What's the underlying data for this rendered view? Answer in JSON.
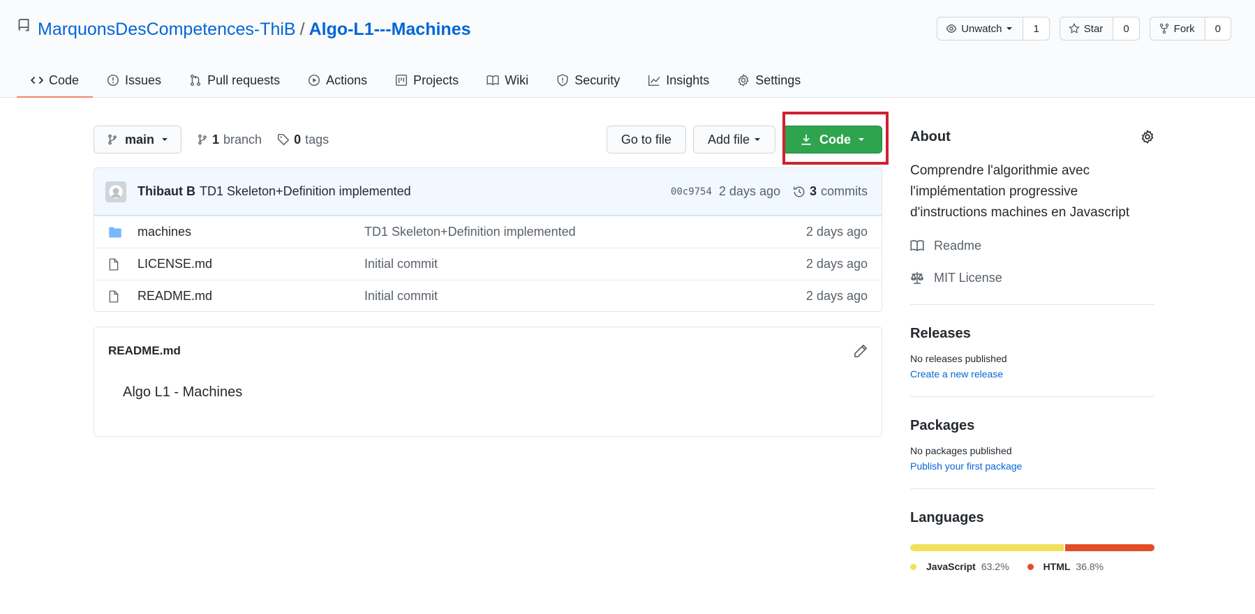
{
  "repo": {
    "owner": "MarquonsDesCompetences-ThiB",
    "separator": "/",
    "name": "Algo-L1---Machines"
  },
  "header_actions": {
    "watch_label": "Unwatch",
    "watch_count": "1",
    "star_label": "Star",
    "star_count": "0",
    "fork_label": "Fork",
    "fork_count": "0"
  },
  "tabs": [
    {
      "label": "Code",
      "icon": "code-icon"
    },
    {
      "label": "Issues",
      "icon": "issue-icon"
    },
    {
      "label": "Pull requests",
      "icon": "pull-request-icon"
    },
    {
      "label": "Actions",
      "icon": "play-icon"
    },
    {
      "label": "Projects",
      "icon": "project-icon"
    },
    {
      "label": "Wiki",
      "icon": "book-icon"
    },
    {
      "label": "Security",
      "icon": "shield-icon"
    },
    {
      "label": "Insights",
      "icon": "graph-icon"
    },
    {
      "label": "Settings",
      "icon": "gear-icon"
    }
  ],
  "filenav": {
    "branch": "main",
    "branch_count": "1",
    "branch_word": "branch",
    "tag_count": "0",
    "tag_word": "tags",
    "go_to_file": "Go to file",
    "add_file": "Add file",
    "code": "Code"
  },
  "latest_commit": {
    "author": "Thibaut B",
    "message": "TD1 Skeleton+Definition implemented",
    "sha": "00c9754",
    "age": "2 days ago",
    "commit_count": "3",
    "commit_word": "commits"
  },
  "files": [
    {
      "type": "dir",
      "name": "machines",
      "message": "TD1 Skeleton+Definition implemented",
      "age": "2 days ago"
    },
    {
      "type": "file",
      "name": "LICENSE.md",
      "message": "Initial commit",
      "age": "2 days ago"
    },
    {
      "type": "file",
      "name": "README.md",
      "message": "Initial commit",
      "age": "2 days ago"
    }
  ],
  "readme": {
    "title": "README.md",
    "content": "Algo L1 - Machines"
  },
  "about": {
    "title": "About",
    "description": "Comprendre l'algorithmie avec l'implémentation progressive d'instructions machines en Javascript",
    "readme_link": "Readme",
    "license_link": "MIT License"
  },
  "releases": {
    "title": "Releases",
    "none": "No releases published",
    "create": "Create a new release"
  },
  "packages": {
    "title": "Packages",
    "none": "No packages published",
    "publish": "Publish your first package"
  },
  "languages": {
    "title": "Languages",
    "items": [
      {
        "name": "JavaScript",
        "percent": "63.2%",
        "value": 63.2,
        "color": "#f1e05a"
      },
      {
        "name": "HTML",
        "percent": "36.8%",
        "value": 36.8,
        "color": "#e34c26"
      }
    ]
  },
  "colors": {
    "link": "#0366d6",
    "primary_button": "#2ea44f",
    "highlight_box": "#d0202f",
    "active_tab_underline": "#f9826c"
  }
}
